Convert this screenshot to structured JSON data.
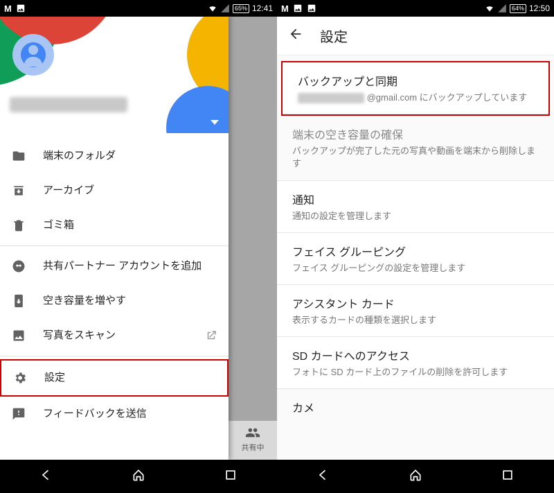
{
  "left": {
    "status": {
      "battery": "65%",
      "time": "12:41"
    },
    "drawer": {
      "items": [
        {
          "icon": "folder-icon",
          "label": "端末のフォルダ"
        },
        {
          "icon": "archive-icon",
          "label": "アーカイブ"
        },
        {
          "icon": "trash-icon",
          "label": "ゴミ箱"
        },
        {
          "icon": "partner-icon",
          "label": "共有パートナー アカウントを追加"
        },
        {
          "icon": "storage-icon",
          "label": "空き容量を増やす"
        },
        {
          "icon": "scan-icon",
          "label": "写真をスキャン",
          "external": true
        },
        {
          "icon": "gear-icon",
          "label": "設定",
          "highlight": true
        },
        {
          "icon": "feedback-icon",
          "label": "フィードバックを送信"
        }
      ]
    },
    "bottom_tab_label": "共有中"
  },
  "right": {
    "status": {
      "battery": "64%",
      "time": "12:50"
    },
    "appbar_title": "設定",
    "settings": [
      {
        "title": "バックアップと同期",
        "sub_suffix": "@gmail.com にバックアップしています",
        "highlight": true
      },
      {
        "title": "端末の空き容量の確保",
        "sub": "バックアップが完了した元の写真や動画を端末から削除します",
        "muted": true
      },
      {
        "title": "通知",
        "sub": "通知の設定を管理します"
      },
      {
        "title": "フェイス グルーピング",
        "sub": "フェイス グルーピングの設定を管理します"
      },
      {
        "title": "アシスタント カード",
        "sub": "表示するカードの種類を選択します"
      },
      {
        "title": "SD カードへのアクセス",
        "sub": "フォトに SD カード上のファイルの削除を許可します"
      }
    ],
    "cut_title_partial": "カメ"
  }
}
